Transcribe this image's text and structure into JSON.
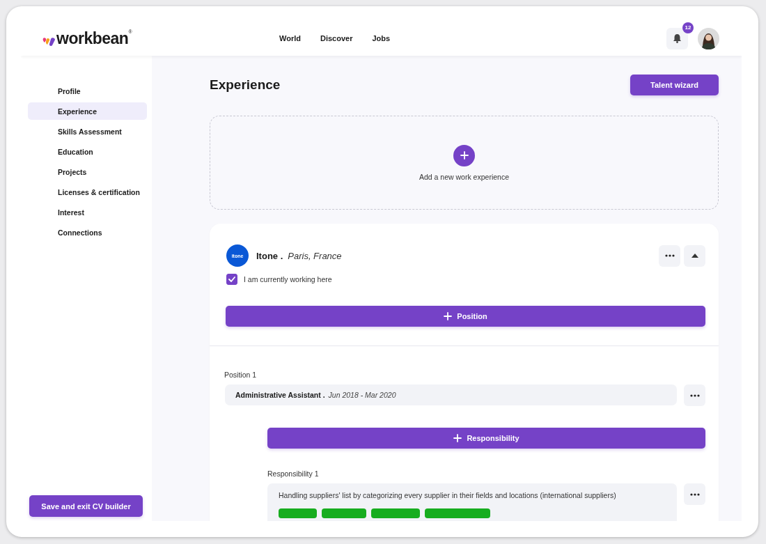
{
  "header": {
    "logo": "workbean",
    "logo_mark": "®",
    "nav": [
      {
        "label": "World"
      },
      {
        "label": "Discover"
      },
      {
        "label": "Jobs"
      }
    ],
    "notifications": "12"
  },
  "sidebar": {
    "items": [
      {
        "label": "Profile",
        "selected": false
      },
      {
        "label": "Experience",
        "selected": true
      },
      {
        "label": "Skills Assessment",
        "selected": false
      },
      {
        "label": "Education",
        "selected": false
      },
      {
        "label": "Projects",
        "selected": false
      },
      {
        "label": "Licenses & certification",
        "selected": false
      },
      {
        "label": "Interest",
        "selected": false
      },
      {
        "label": "Connections",
        "selected": false
      }
    ],
    "save_button": "Save and exit CV builder"
  },
  "main": {
    "title": "Experience",
    "wizard_button": "Talent wizard",
    "add_experience": "Add a new work experience",
    "company": {
      "logo": "itone",
      "name": "Itone .",
      "location": "Paris, France",
      "current_label": "I am currently working here",
      "current": true,
      "position_button": "Position",
      "positions": [
        {
          "label": "Position 1",
          "title": "Administrative Assistant .",
          "dates": "Jun 2018 - Mar 2020",
          "responsibility_button": "Responsibility",
          "responsibilities": [
            {
              "label": "Responsibility 1",
              "text": "Handling suppliers' list by categorizing every supplier in their fields and locations (international suppliers)"
            }
          ]
        }
      ]
    }
  }
}
